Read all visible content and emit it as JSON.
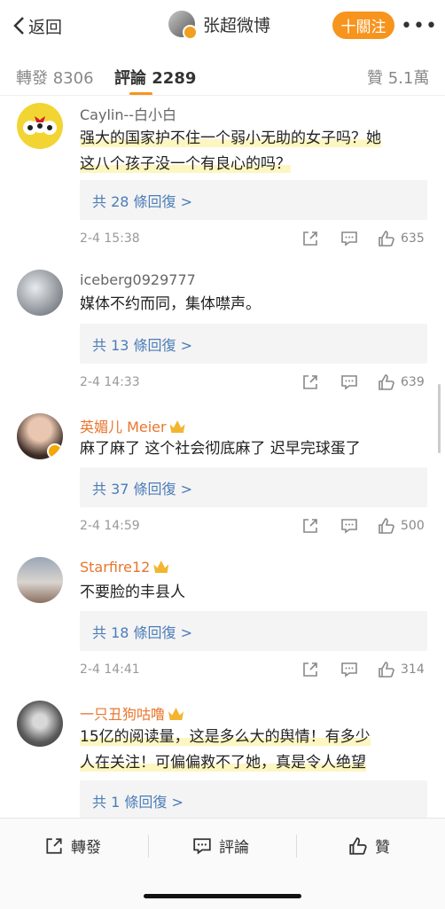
{
  "header": {
    "back_label": "返回",
    "username": "张超微博",
    "follow_label": "十關注",
    "more_label": "•••"
  },
  "tabs": [
    {
      "label": "轉發 8306"
    },
    {
      "label": "評論 2289"
    },
    {
      "label": "贊 5.1萬"
    }
  ],
  "comments": [
    {
      "user": "Caylin--白小白",
      "text_lines": [
        "强大的国家护不住一个弱小无助的女子吗？她",
        "这八个孩子没一个有良心的吗？"
      ],
      "replies": "共 28 條回復 >",
      "time": "2-4 15:38",
      "likes": "635"
    },
    {
      "user": "iceberg0929777",
      "text_lines": [
        "媒体不约而同，集体噤声。"
      ],
      "replies": "共 13 條回復 >",
      "time": "2-4 14:33",
      "likes": "639"
    },
    {
      "user": "英媚儿 Meier",
      "text_lines": [
        "麻了麻了 这个社会彻底麻了 迟早完球蛋了"
      ],
      "replies": "共 37 條回復 >",
      "time": "2-4 14:59",
      "likes": "500"
    },
    {
      "user": "Starfire12",
      "text_lines": [
        "不要脸的丰县人"
      ],
      "replies": "共 18 條回復 >",
      "time": "2-4 14:41",
      "likes": "314"
    },
    {
      "user": "一只丑狗咕噜",
      "text_lines": [
        "15亿的阅读量，这是多么大的舆情！有多少",
        "人在关注！可偏偏救不了她，真是令人绝望"
      ],
      "replies": "共 1 條回復 >"
    }
  ],
  "bottom_bar": {
    "repost": "轉發",
    "comment": "評論",
    "like": "贊"
  },
  "colors": {
    "accent": "#f7941d",
    "link": "#4b7db8",
    "vip_name": "#e8762d"
  }
}
